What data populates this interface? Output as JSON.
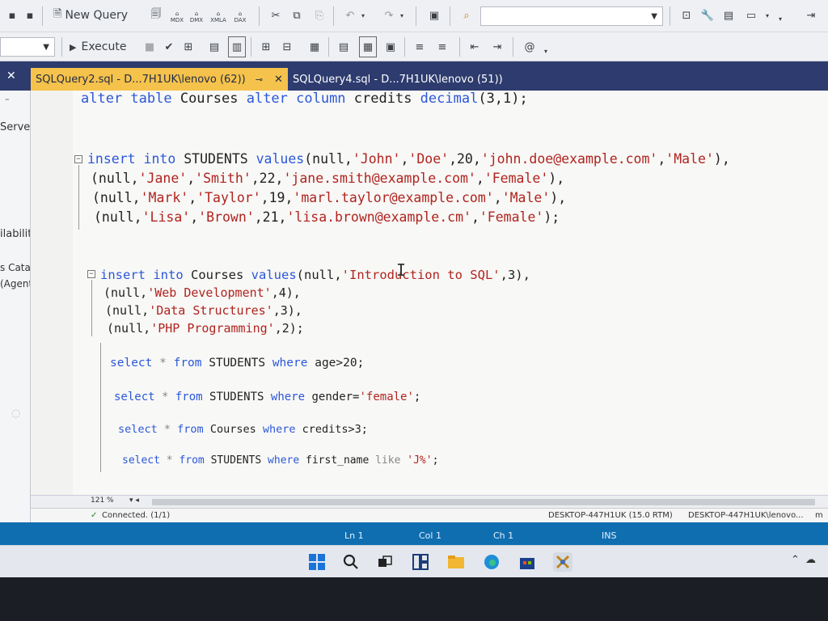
{
  "toolbar": {
    "new_query_label": "New Query",
    "execute_label": "Execute",
    "mini_labels": [
      "MDX",
      "DMX",
      "XMLA",
      "DAX"
    ],
    "search_placeholder": ""
  },
  "tabs": [
    {
      "label": "SQLQuery2.sql - D...7H1UK\\lenovo (62))",
      "pin": "⊸",
      "close": "✕",
      "active": true
    },
    {
      "label": "SQLQuery4.sql - D...7H1UK\\lenovo (51))",
      "active": false
    }
  ],
  "sidebar": {
    "items": [
      "Serve",
      "ilability",
      "s Catalogs",
      "(Agent XPs"
    ]
  },
  "editor": {
    "zoom": "121 %",
    "lines": [
      {
        "parts": [
          {
            "t": "alter table",
            "c": "kw"
          },
          {
            "t": " Courses ",
            "c": ""
          },
          {
            "t": "alter column",
            "c": "kw"
          },
          {
            "t": " credits ",
            "c": ""
          },
          {
            "t": "decimal",
            "c": "kw"
          },
          {
            "t": "(3,1);",
            "c": ""
          }
        ]
      },
      {
        "parts": [
          {
            "t": "insert into",
            "c": "kw"
          },
          {
            "t": " STUDENTS ",
            "c": ""
          },
          {
            "t": "values",
            "c": "kw"
          },
          {
            "t": "(null,",
            "c": ""
          },
          {
            "t": "'John'",
            "c": "str"
          },
          {
            "t": ",",
            "c": ""
          },
          {
            "t": "'Doe'",
            "c": "str"
          },
          {
            "t": ",20,",
            "c": ""
          },
          {
            "t": "'john.doe@example.com'",
            "c": "str"
          },
          {
            "t": ",",
            "c": ""
          },
          {
            "t": "'Male'",
            "c": "str"
          },
          {
            "t": "),",
            "c": ""
          }
        ]
      },
      {
        "parts": [
          {
            "t": "(null,",
            "c": ""
          },
          {
            "t": "'Jane'",
            "c": "str"
          },
          {
            "t": ",",
            "c": ""
          },
          {
            "t": "'Smith'",
            "c": "str"
          },
          {
            "t": ",22,",
            "c": ""
          },
          {
            "t": "'jane.smith@example.com'",
            "c": "str"
          },
          {
            "t": ",",
            "c": ""
          },
          {
            "t": "'Female'",
            "c": "str"
          },
          {
            "t": "),",
            "c": ""
          }
        ]
      },
      {
        "parts": [
          {
            "t": "(null,",
            "c": ""
          },
          {
            "t": "'Mark'",
            "c": "str"
          },
          {
            "t": ",",
            "c": ""
          },
          {
            "t": "'Taylor'",
            "c": "str"
          },
          {
            "t": ",19,",
            "c": ""
          },
          {
            "t": "'marl.taylor@example.com'",
            "c": "str"
          },
          {
            "t": ",",
            "c": ""
          },
          {
            "t": "'Male'",
            "c": "str"
          },
          {
            "t": "),",
            "c": ""
          }
        ]
      },
      {
        "parts": [
          {
            "t": "(null,",
            "c": ""
          },
          {
            "t": "'Lisa'",
            "c": "str"
          },
          {
            "t": ",",
            "c": ""
          },
          {
            "t": "'Brown'",
            "c": "str"
          },
          {
            "t": ",21,",
            "c": ""
          },
          {
            "t": "'lisa.brown@example.cm'",
            "c": "str"
          },
          {
            "t": ",",
            "c": ""
          },
          {
            "t": "'Female'",
            "c": "str"
          },
          {
            "t": ");",
            "c": ""
          }
        ]
      },
      {
        "parts": [
          {
            "t": "insert into",
            "c": "kw"
          },
          {
            "t": " Courses ",
            "c": ""
          },
          {
            "t": "values",
            "c": "kw"
          },
          {
            "t": "(null,",
            "c": ""
          },
          {
            "t": "'Introduction to SQL'",
            "c": "str"
          },
          {
            "t": ",3),",
            "c": ""
          }
        ]
      },
      {
        "parts": [
          {
            "t": "(null,",
            "c": ""
          },
          {
            "t": "'Web Development'",
            "c": "str"
          },
          {
            "t": ",4),",
            "c": ""
          }
        ]
      },
      {
        "parts": [
          {
            "t": "(null,",
            "c": ""
          },
          {
            "t": "'Data Structures'",
            "c": "str"
          },
          {
            "t": ",3),",
            "c": ""
          }
        ]
      },
      {
        "parts": [
          {
            "t": "(null,",
            "c": ""
          },
          {
            "t": "'PHP Programming'",
            "c": "str"
          },
          {
            "t": ",2);",
            "c": ""
          }
        ]
      },
      {
        "parts": [
          {
            "t": "select",
            "c": "kw"
          },
          {
            "t": " * ",
            "c": "op"
          },
          {
            "t": "from",
            "c": "kw"
          },
          {
            "t": " STUDENTS ",
            "c": ""
          },
          {
            "t": "where",
            "c": "kw"
          },
          {
            "t": " age>20;",
            "c": ""
          }
        ]
      },
      {
        "parts": [
          {
            "t": "select",
            "c": "kw"
          },
          {
            "t": " * ",
            "c": "op"
          },
          {
            "t": "from",
            "c": "kw"
          },
          {
            "t": " STUDENTS ",
            "c": ""
          },
          {
            "t": "where",
            "c": "kw"
          },
          {
            "t": " gender=",
            "c": ""
          },
          {
            "t": "'female'",
            "c": "str"
          },
          {
            "t": ";",
            "c": ""
          }
        ]
      },
      {
        "parts": [
          {
            "t": "select",
            "c": "kw"
          },
          {
            "t": " * ",
            "c": "op"
          },
          {
            "t": "from",
            "c": "kw"
          },
          {
            "t": " Courses ",
            "c": ""
          },
          {
            "t": "where",
            "c": "kw"
          },
          {
            "t": " credits>3;",
            "c": ""
          }
        ]
      },
      {
        "parts": [
          {
            "t": "select",
            "c": "kw"
          },
          {
            "t": " * ",
            "c": "op"
          },
          {
            "t": "from",
            "c": "kw"
          },
          {
            "t": " STUDENTS ",
            "c": ""
          },
          {
            "t": "where",
            "c": "kw"
          },
          {
            "t": " first_name ",
            "c": ""
          },
          {
            "t": "like",
            "c": "op"
          },
          {
            "t": " ",
            "c": ""
          },
          {
            "t": "'J%'",
            "c": "str"
          },
          {
            "t": ";",
            "c": ""
          }
        ]
      }
    ]
  },
  "status": {
    "connection": "Connected. (1/1)",
    "server": "DESKTOP-447H1UK (15.0 RTM)",
    "user": "DESKTOP-447H1UK\\lenovo...",
    "overflow": "m",
    "ln": "Ln 1",
    "col": "Col 1",
    "ch": "Ch 1",
    "mode": "INS"
  },
  "taskbar": {
    "items": [
      "windows-start-icon",
      "search-icon",
      "task-view-icon",
      "widgets-icon",
      "file-explorer-icon",
      "edge-browser-icon",
      "store-icon",
      "ssms-icon"
    ]
  },
  "colors": {
    "keyword": "#2b57d9",
    "string": "#b0241f",
    "active_tab": "#f5c24c",
    "tabstrip": "#2d3b6e",
    "statusbar": "#0f6eb0"
  }
}
